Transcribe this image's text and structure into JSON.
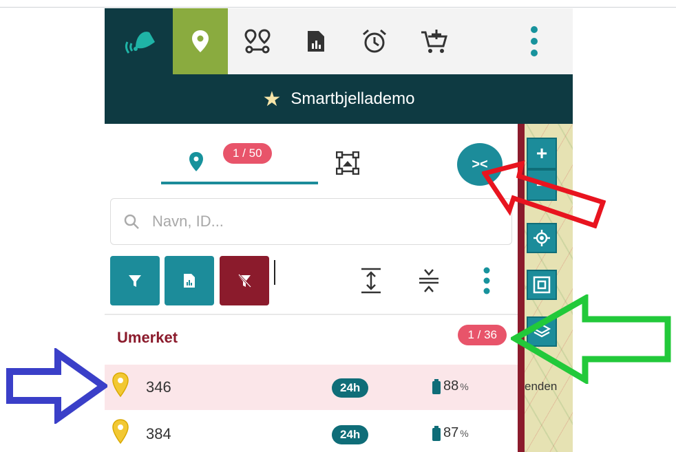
{
  "toolbar": {
    "icons": [
      "bell-logo-icon",
      "map-pin-icon",
      "route-icon",
      "report-icon",
      "alarm-icon",
      "cart-add-icon",
      "more-vert-icon"
    ],
    "active_index": 1
  },
  "header": {
    "title": "Smartbjellademo"
  },
  "tabs": {
    "location_badge": "1 / 50"
  },
  "search": {
    "placeholder": "Navn, ID..."
  },
  "group": {
    "title": "Umerket",
    "count_badge": "1 / 36"
  },
  "rows": [
    {
      "name": "346",
      "interval": "24h",
      "battery": "88",
      "unit": "%",
      "selected": true
    },
    {
      "name": "384",
      "interval": "24h",
      "battery": "87",
      "unit": "%",
      "selected": false
    }
  ],
  "map": {
    "place_text": "enden"
  },
  "colors": {
    "dark_teal": "#0e3a42",
    "accent_green": "#8aab3f",
    "teal": "#1c8c9a",
    "badge_red": "#e8546a",
    "maroon": "#8b1b2c",
    "pin_yellow": "#f2c833"
  }
}
